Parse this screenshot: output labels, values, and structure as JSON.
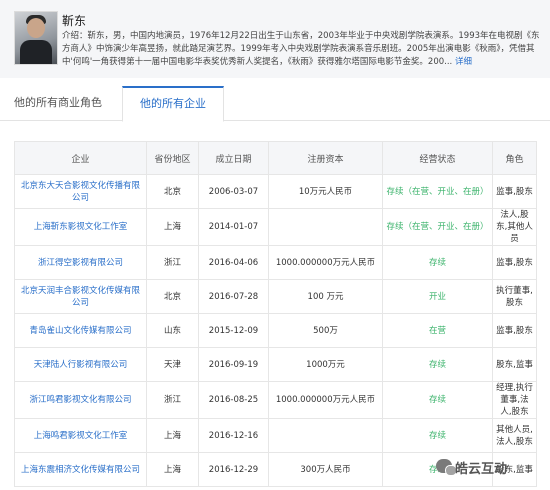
{
  "profile": {
    "name": "靳东",
    "bio": "介绍：靳东，男，中国内地演员，1976年12月22日出生于山东省，2003年毕业于中央戏剧学院表演系。1993年在电视剧《东方商人》中饰演少年高昱扬，就此踏足演艺界。1999年考入中央戏剧学院表演系音乐剧班。2005年出演电影《秋雨》，凭借其中'何鸣'一角获得第十一届中国电影华表奖优秀新人奖提名，《秋雨》获得雅尔塔国际电影节金奖。200... ",
    "more": "详细"
  },
  "tabs": [
    "他的所有商业角色",
    "他的所有企业"
  ],
  "table": {
    "headers": [
      "企业",
      "省份地区",
      "成立日期",
      "注册资本",
      "经营状态",
      "角色"
    ],
    "rows": [
      [
        "北京东大天合影视文化传播有限公司",
        "北京",
        "2006-03-07",
        "10万元人民币",
        "存续（在营、开业、在册）",
        "监事,股东"
      ],
      [
        "上海靳东影视文化工作室",
        "上海",
        "2014-01-07",
        "",
        "存续（在营、开业、在册）",
        "法人,股东,其他人员"
      ],
      [
        "浙江得空影视有限公司",
        "浙江",
        "2016-04-06",
        "1000.000000万元人民币",
        "存续",
        "监事,股东"
      ],
      [
        "北京天润丰合影视文化传媒有限公司",
        "北京",
        "2016-07-28",
        "100 万元",
        "开业",
        "执行董事,股东"
      ],
      [
        "青岛雀山文化传媒有限公司",
        "山东",
        "2015-12-09",
        "500万",
        "在营",
        "监事,股东"
      ],
      [
        "天津陆人行影视有限公司",
        "天津",
        "2016-09-19",
        "1000万元",
        "存续",
        "股东,监事"
      ],
      [
        "浙江鸣君影视文化有限公司",
        "浙江",
        "2016-08-25",
        "1000.000000万元人民币",
        "存续",
        "经理,执行董事,法人,股东"
      ],
      [
        "上海鸣君影视文化工作室",
        "上海",
        "2016-12-16",
        "",
        "存续",
        "其他人员,法人,股东"
      ],
      [
        "上海东震相济文化传媒有限公司",
        "上海",
        "2016-12-29",
        "300万人民币",
        "存续",
        "股东,监事"
      ]
    ]
  },
  "watermark": "皓云互动"
}
